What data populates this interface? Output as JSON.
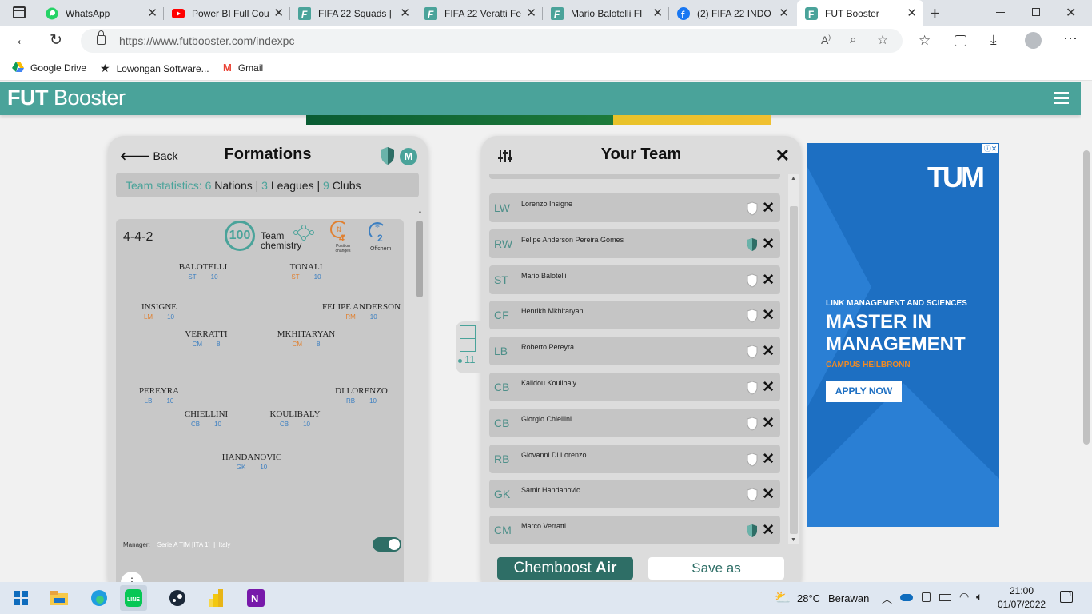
{
  "browser": {
    "tabs": [
      {
        "title": "WhatsApp",
        "icon": "whatsapp-icon"
      },
      {
        "title": "Power BI Full Cou",
        "icon": "youtube-icon"
      },
      {
        "title": "FIFA 22 Squads |",
        "icon": "futbin-icon"
      },
      {
        "title": "FIFA 22 Veratti Fe",
        "icon": "futbin-icon"
      },
      {
        "title": "Mario Balotelli FI",
        "icon": "futbin-icon"
      },
      {
        "title": "(2) FIFA 22 INDO",
        "icon": "facebook-icon"
      },
      {
        "title": "FUT Booster",
        "icon": "futbooster-icon"
      }
    ],
    "url": "https://www.futbooster.com/indexpc",
    "bookmarks": [
      "Google Drive",
      "Lowongan Software...",
      "Gmail"
    ]
  },
  "site": {
    "logo_bold": "FUT",
    "logo_rest": "Booster"
  },
  "formations": {
    "back": "Back",
    "title": "Formations",
    "manager_badge": "M",
    "stats": {
      "label": "Team statistics:",
      "nations_n": "6",
      "nations": "Nations",
      "leagues_n": "3",
      "leagues": "Leagues",
      "clubs_n": "9",
      "clubs": "Clubs",
      "sep": "|"
    },
    "formation": "4-4-2",
    "chem_value": "100",
    "chem_label_1": "Team",
    "chem_label_2": "chemistry",
    "pos_changes": "4",
    "pos_changes_label_1": "Position",
    "pos_changes_label_2": "changes",
    "offchem": "2",
    "offchem_label": "Offchem",
    "players": [
      {
        "name": "BALOTELLI",
        "pos": "ST",
        "chem": "10"
      },
      {
        "name": "TONALI",
        "pos": "ST",
        "chem": "10"
      },
      {
        "name": "INSIGNE",
        "pos": "LM",
        "chem": "10"
      },
      {
        "name": "FELIPE ANDERSON",
        "pos": "RM",
        "chem": "10"
      },
      {
        "name": "VERRATTI",
        "pos": "CM",
        "chem": "8"
      },
      {
        "name": "MKHITARYAN",
        "pos": "CM",
        "chem": "8"
      },
      {
        "name": "PEREYRA",
        "pos": "LB",
        "chem": "10"
      },
      {
        "name": "DI LORENZO",
        "pos": "RB",
        "chem": "10"
      },
      {
        "name": "CHIELLINI",
        "pos": "CB",
        "chem": "10"
      },
      {
        "name": "KOULIBALY",
        "pos": "CB",
        "chem": "10"
      },
      {
        "name": "HANDANOVIC",
        "pos": "GK",
        "chem": "10"
      }
    ],
    "manager_label": "Manager:",
    "manager_league": "Serie A TIM [ITA 1]",
    "manager_sep": "|",
    "manager_nation": "Italy"
  },
  "team": {
    "title": "Your Team",
    "count": "11",
    "rows": [
      {
        "pos": "LW",
        "name": "Lorenzo Insigne",
        "loyal": false
      },
      {
        "pos": "RW",
        "name": "Felipe Anderson Pereira Gomes",
        "loyal": true
      },
      {
        "pos": "ST",
        "name": "Mario Balotelli",
        "loyal": false
      },
      {
        "pos": "CF",
        "name": "Henrikh Mkhitaryan",
        "loyal": false
      },
      {
        "pos": "LB",
        "name": "Roberto Pereyra",
        "loyal": false
      },
      {
        "pos": "CB",
        "name": "Kalidou Koulibaly",
        "loyal": false
      },
      {
        "pos": "CB",
        "name": "Giorgio Chiellini",
        "loyal": false
      },
      {
        "pos": "RB",
        "name": "Giovanni Di Lorenzo",
        "loyal": false
      },
      {
        "pos": "GK",
        "name": "Samir Handanovic",
        "loyal": false
      },
      {
        "pos": "CM",
        "name": "Marco Verratti",
        "loyal": true
      }
    ],
    "chemboost_a": "Chemboost",
    "chemboost_b": "Air",
    "save": "Save as"
  },
  "ad": {
    "brand": "TUM",
    "line1": "LINK MANAGEMENT AND SCIENCES",
    "line2": "MASTER IN",
    "line3": "MANAGEMENT",
    "line4": "CAMPUS HEILBRONN",
    "cta": "APPLY NOW"
  },
  "taskbar": {
    "temp": "28°C",
    "weather": "Berawan",
    "time": "21:00",
    "date": "01/07/2022"
  },
  "colors": {
    "accent": "#4aa39a",
    "dark_teal": "#2e6e66",
    "ad_blue": "#1d6fc2"
  }
}
